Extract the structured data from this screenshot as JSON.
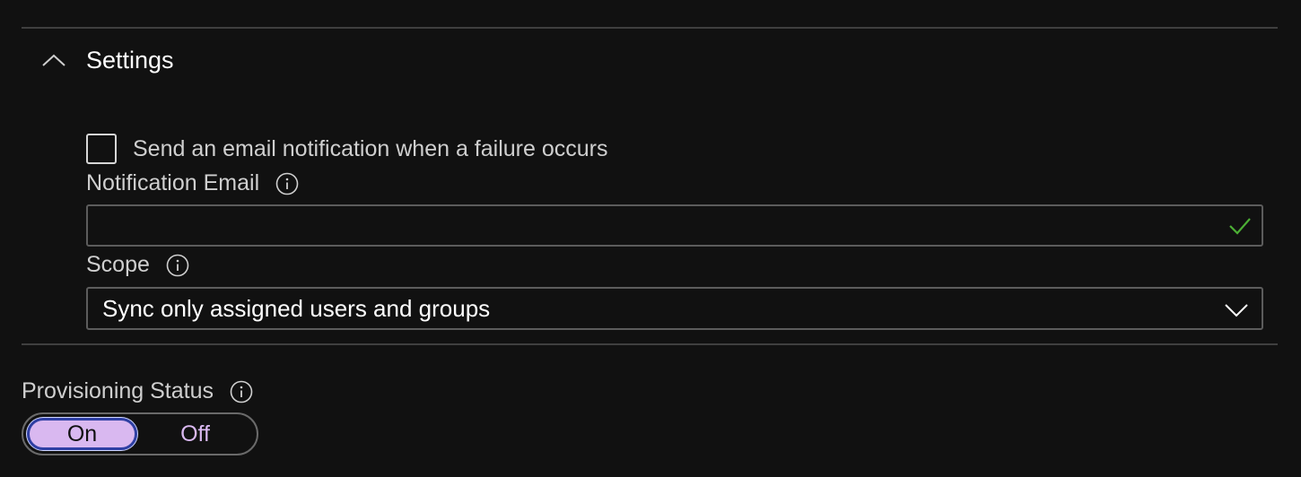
{
  "settings_section": {
    "title": "Settings",
    "expanded": true
  },
  "notification": {
    "checkbox_label": "Send an email notification when a failure occurs",
    "checked": false,
    "email_label": "Notification Email",
    "email_value": "",
    "email_valid": true
  },
  "scope": {
    "label": "Scope",
    "selected": "Sync only assigned users and groups"
  },
  "provisioning_status": {
    "label": "Provisioning Status",
    "on_label": "On",
    "off_label": "Off",
    "selected": "On"
  },
  "colors": {
    "background": "#111111",
    "toggle_selected": "#d9b8f0",
    "valid_check": "#4caf35"
  }
}
